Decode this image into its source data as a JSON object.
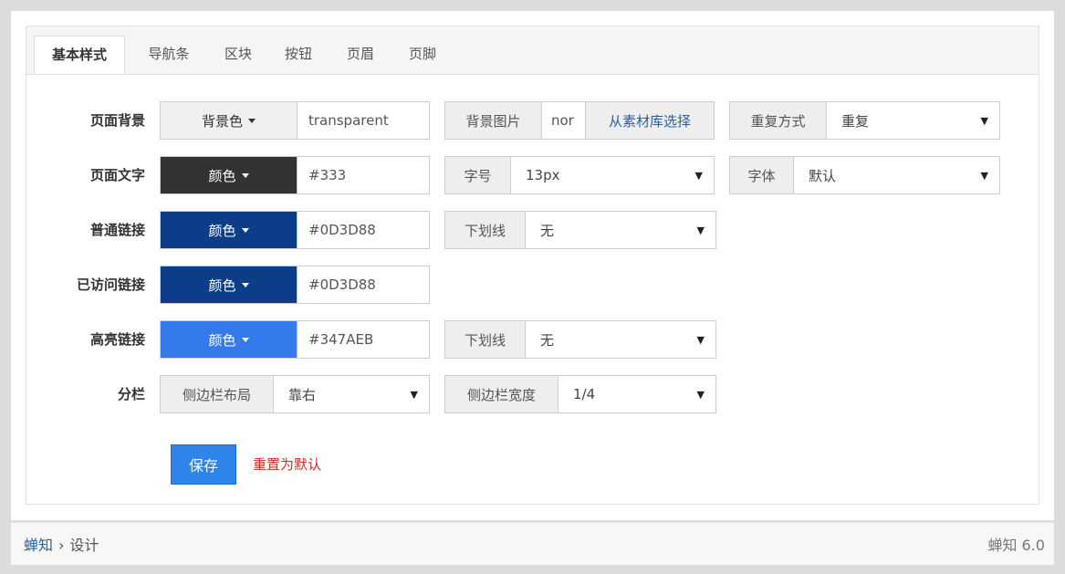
{
  "tabs": [
    "基本样式",
    "导航条",
    "区块",
    "按钮",
    "页眉",
    "页脚"
  ],
  "rows": {
    "page_bg": {
      "label": "页面背景",
      "color_btn": "背景色",
      "color_value": "transparent",
      "image_label": "背景图片",
      "image_value": "nor",
      "image_pick": "从素材库选择",
      "repeat_label": "重复方式",
      "repeat_value": "重复"
    },
    "page_text": {
      "label": "页面文字",
      "color_btn": "颜色",
      "color_value": "#333",
      "size_label": "字号",
      "size_value": "13px",
      "font_label": "字体",
      "font_value": "默认"
    },
    "link": {
      "label": "普通链接",
      "color_btn": "颜色",
      "color_value": "#0D3D88",
      "underline_label": "下划线",
      "underline_value": "无"
    },
    "visited": {
      "label": "已访问链接",
      "color_btn": "颜色",
      "color_value": "#0D3D88"
    },
    "hover": {
      "label": "高亮链接",
      "color_btn": "颜色",
      "color_value": "#347AEB",
      "underline_label": "下划线",
      "underline_value": "无"
    },
    "columns": {
      "label": "分栏",
      "sidebar_layout_label": "侧边栏布局",
      "sidebar_layout_value": "靠右",
      "sidebar_width_label": "侧边栏宽度",
      "sidebar_width_value": "1/4"
    }
  },
  "actions": {
    "save": "保存",
    "reset": "重置为默认"
  },
  "footer": {
    "crumb_home": "蝉知",
    "crumb_sep": "›",
    "crumb_current": "设计",
    "version": "蝉知 6.0"
  },
  "colors": {
    "text_swatch": "#333333",
    "link_swatch": "#0D3D88",
    "visited_swatch": "#0D3D88",
    "hover_swatch": "#347AEB",
    "save_button": "#2f84ea",
    "reset_link": "#c9302c"
  },
  "icons": {
    "caret": "caret-down-icon",
    "select_arrow": "triangle-down-icon"
  }
}
